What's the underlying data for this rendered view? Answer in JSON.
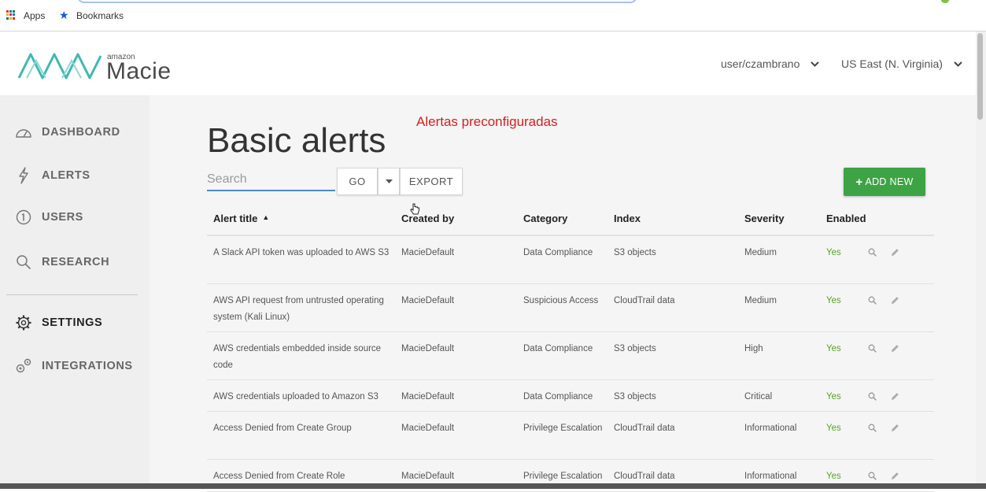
{
  "browser": {
    "bookmarks": [
      {
        "label": "Apps",
        "icon": "apps-grid-icon"
      },
      {
        "label": "Bookmarks",
        "icon": "star-icon"
      }
    ]
  },
  "header": {
    "logo_small": "amazon",
    "logo_name": "Macie",
    "user_menu": "user/czambrano",
    "region_menu": "US East (N. Virginia)"
  },
  "sidebar": {
    "items": [
      {
        "label": "DASHBOARD",
        "icon": "dashboard-gauge-icon"
      },
      {
        "label": "ALERTS",
        "icon": "lightning-bolt-icon"
      },
      {
        "label": "USERS",
        "icon": "user-circle-icon"
      },
      {
        "label": "RESEARCH",
        "icon": "magnifier-icon"
      },
      {
        "label": "SETTINGS",
        "icon": "gear-icon",
        "active": true
      },
      {
        "label": "INTEGRATIONS",
        "icon": "gears-icon"
      }
    ]
  },
  "main": {
    "title": "Basic alerts",
    "annotation": "Alertas preconfiguradas",
    "search_placeholder": "Search",
    "go_label": "GO",
    "export_label": "EXPORT",
    "add_new_label": "ADD NEW",
    "table": {
      "columns": [
        "Alert title",
        "Created by",
        "Category",
        "Index",
        "Severity",
        "Enabled"
      ],
      "sorted_column": "Alert title",
      "rows": [
        {
          "title": "A Slack API token was uploaded to AWS S3",
          "created_by": "MacieDefault",
          "category": "Data Compliance",
          "index": "S3 objects",
          "severity": "Medium",
          "enabled": "Yes"
        },
        {
          "title": "AWS API request from untrusted operating system (Kali Linux)",
          "created_by": "MacieDefault",
          "category": "Suspicious Access",
          "index": "CloudTrail data",
          "severity": "Medium",
          "enabled": "Yes"
        },
        {
          "title": "AWS credentials embedded inside source code",
          "created_by": "MacieDefault",
          "category": "Data Compliance",
          "index": "S3 objects",
          "severity": "High",
          "enabled": "Yes"
        },
        {
          "title": "AWS credentials uploaded to Amazon S3",
          "created_by": "MacieDefault",
          "category": "Data Compliance",
          "index": "S3 objects",
          "severity": "Critical",
          "enabled": "Yes"
        },
        {
          "title": "Access Denied from Create Group",
          "created_by": "MacieDefault",
          "category": "Privilege Escalation",
          "index": "CloudTrail data",
          "severity": "Informational",
          "enabled": "Yes"
        },
        {
          "title": "Access Denied from Create Role",
          "created_by": "MacieDefault",
          "category": "Privilege Escalation",
          "index": "CloudTrail data",
          "severity": "Informational",
          "enabled": "Yes"
        }
      ]
    }
  },
  "colors": {
    "brand_teal": "#3fb8b0",
    "add_button_green": "#3ea344",
    "enabled_green": "#5aa02c",
    "annotation_red": "#d21f1f",
    "search_underline_blue": "#4a8bd0"
  }
}
